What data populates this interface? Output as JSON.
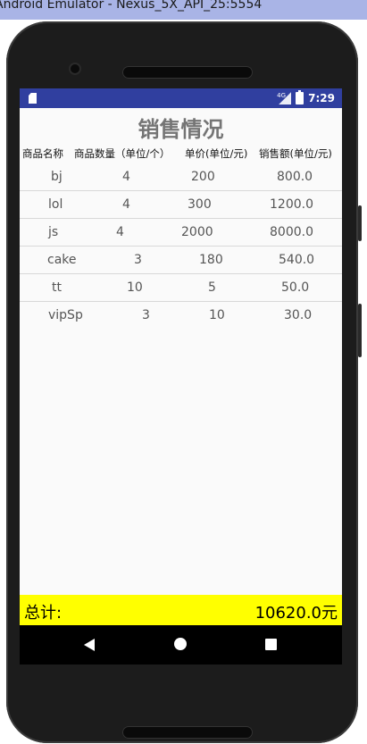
{
  "window": {
    "title": "Android Emulator - Nexus_5X_API_25:5554"
  },
  "status_bar": {
    "time": "7:29",
    "network": "4G"
  },
  "app": {
    "title": "销售情况"
  },
  "table": {
    "headers": [
      "商品名称",
      "商品数量（单位/个）",
      "单价(单位/元)",
      "销售额(单位/元)"
    ],
    "rows": [
      [
        "bj",
        "4",
        "200",
        "800.0"
      ],
      [
        "lol",
        "4",
        "300",
        "1200.0"
      ],
      [
        "js",
        "4",
        "2000",
        "8000.0"
      ],
      [
        "cake",
        "3",
        "180",
        "540.0"
      ],
      [
        "tt",
        "10",
        "5",
        "50.0"
      ],
      [
        "vipSp",
        "3",
        "10",
        "30.0"
      ]
    ]
  },
  "footer": {
    "label": "总计:",
    "total": "10620.0元"
  },
  "colors": {
    "status_bar": "#303f9f",
    "footer_bg": "#ffff00",
    "title_text": "#757575"
  }
}
